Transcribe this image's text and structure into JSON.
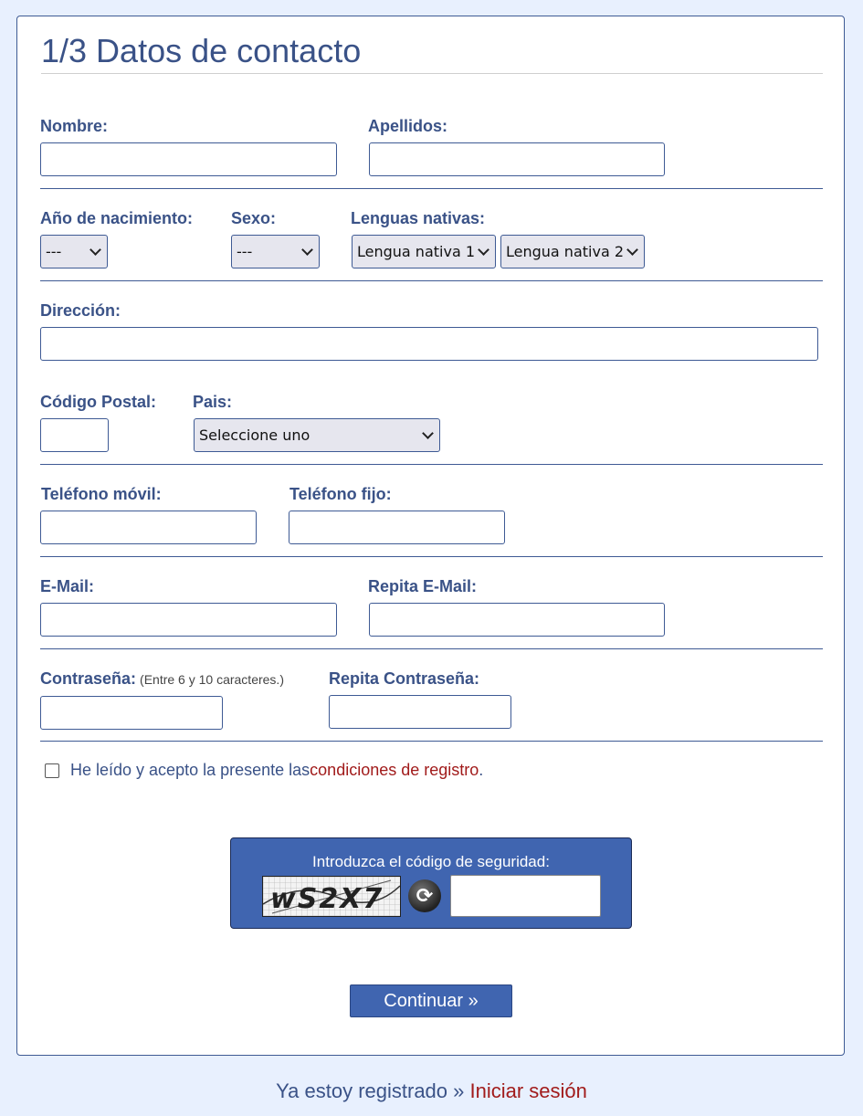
{
  "form": {
    "title": "1/3 Datos de contacto",
    "fields": {
      "nombre_label": "Nombre:",
      "apellidos_label": "Apellidos:",
      "ano_label": "Año de nacimiento:",
      "ano_value": "---",
      "sexo_label": "Sexo:",
      "sexo_value": "---",
      "lenguas_label": "Lenguas nativas:",
      "lengua1_value": "Lengua nativa 1",
      "lengua2_value": "Lengua nativa 2",
      "direccion_label": "Dirección:",
      "cp_label": "Código Postal:",
      "pais_label": "Pais:",
      "pais_value": "Seleccione uno",
      "movil_label": "Teléfono móvil:",
      "fijo_label": "Teléfono fijo:",
      "email_label": "E-Mail:",
      "email2_label": "Repita E-Mail:",
      "password_label": "Contraseña:",
      "password_hint": "(Entre 6 y 10 caracteres.)",
      "password2_label": "Repita Contraseña:"
    },
    "terms": {
      "text": "He leído y acepto la presente las ",
      "link": "condiciones de registro",
      "suffix": "."
    },
    "captcha": {
      "label": "Introduzca el código de seguridad:",
      "image_text": "wS2X7",
      "refresh_icon": "refresh-icon"
    },
    "submit_label": "Continuar »"
  },
  "footer": {
    "text": "Ya estoy registrado » ",
    "link": "Iniciar sesión"
  },
  "colors": {
    "background": "#e8f0fe",
    "primary": "#3a5287",
    "accent_button": "#4065b0",
    "link": "#a11b1b"
  }
}
